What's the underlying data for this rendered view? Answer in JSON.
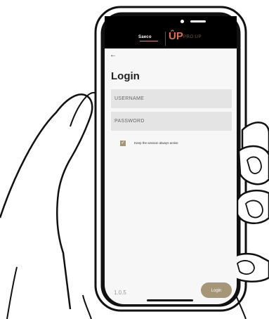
{
  "header": {
    "brand_left": "Saeco",
    "brand_right_mark": "ÛP",
    "brand_right_text": "PRO:UP"
  },
  "nav": {
    "back_icon": "←"
  },
  "login": {
    "title": "Login",
    "username_placeholder": "USERNAME",
    "password_placeholder": "PASSWORD",
    "keep_session_label": "Keep the session always active",
    "keep_session_checked": true,
    "check_icon": "✓",
    "submit_label": "Login"
  },
  "footer": {
    "version": "1.0.5"
  },
  "colors": {
    "accent": "#a59677",
    "header_bg": "#000000",
    "field_bg": "#e4e4e4",
    "screen_bg": "#f7f7f7",
    "up_orange": "#e06d4c"
  }
}
